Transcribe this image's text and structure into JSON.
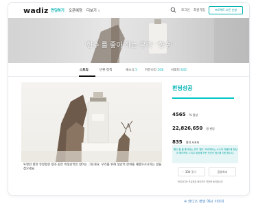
{
  "header": {
    "logo": "wadiz",
    "nav": [
      "펀딩하기",
      "오픈예정",
      "더보기"
    ],
    "search_icon": "search-icon",
    "login": "로그인",
    "signup": "회원가입",
    "open_project": "프로젝트 오픈 신청"
  },
  "banner": {
    "title": "'향수 를 좋아 하는 우리' '향수'"
  },
  "tabs": [
    {
      "label": "스토리",
      "count": ""
    },
    {
      "label": "반환·정책",
      "count": ""
    },
    {
      "label": "새소식",
      "count": "5"
    },
    {
      "label": "커뮤니티",
      "count": "108"
    },
    {
      "label": "서포터",
      "count": "835"
    }
  ],
  "product": {
    "description": "투명한 향한 유향형한 향과 같은 비생산적인 향이는 그린게요. 우리를 위해 생산적 한위를 재향하거나하는 향을 찾으세요."
  },
  "funding": {
    "status": "펀딩성공",
    "percent": "4565",
    "percent_unit": "% 달성",
    "amount": "22,826,650",
    "amount_unit": "원 펀딩",
    "supporters": "835",
    "supporters_unit": "명의 서포터",
    "notice": "'향수'을 을 좋아하는 우리 '향수' 프로젝트는 소수의 카페트에 펀딩과 메이커와 그리고 세상에 모든 자신의 향수를 지원 합니다.",
    "like_count": "334",
    "like_label": "좋아",
    "share_label": "공유하기",
    "footnote": "펀딩하기는 프로젝트 메이커의 약관에 동의합니다"
  },
  "caption": "※ 와디즈 펀딩 예시 이미지",
  "colors": {
    "accent": "#00b2b2",
    "caption": "#3b7fc4"
  }
}
